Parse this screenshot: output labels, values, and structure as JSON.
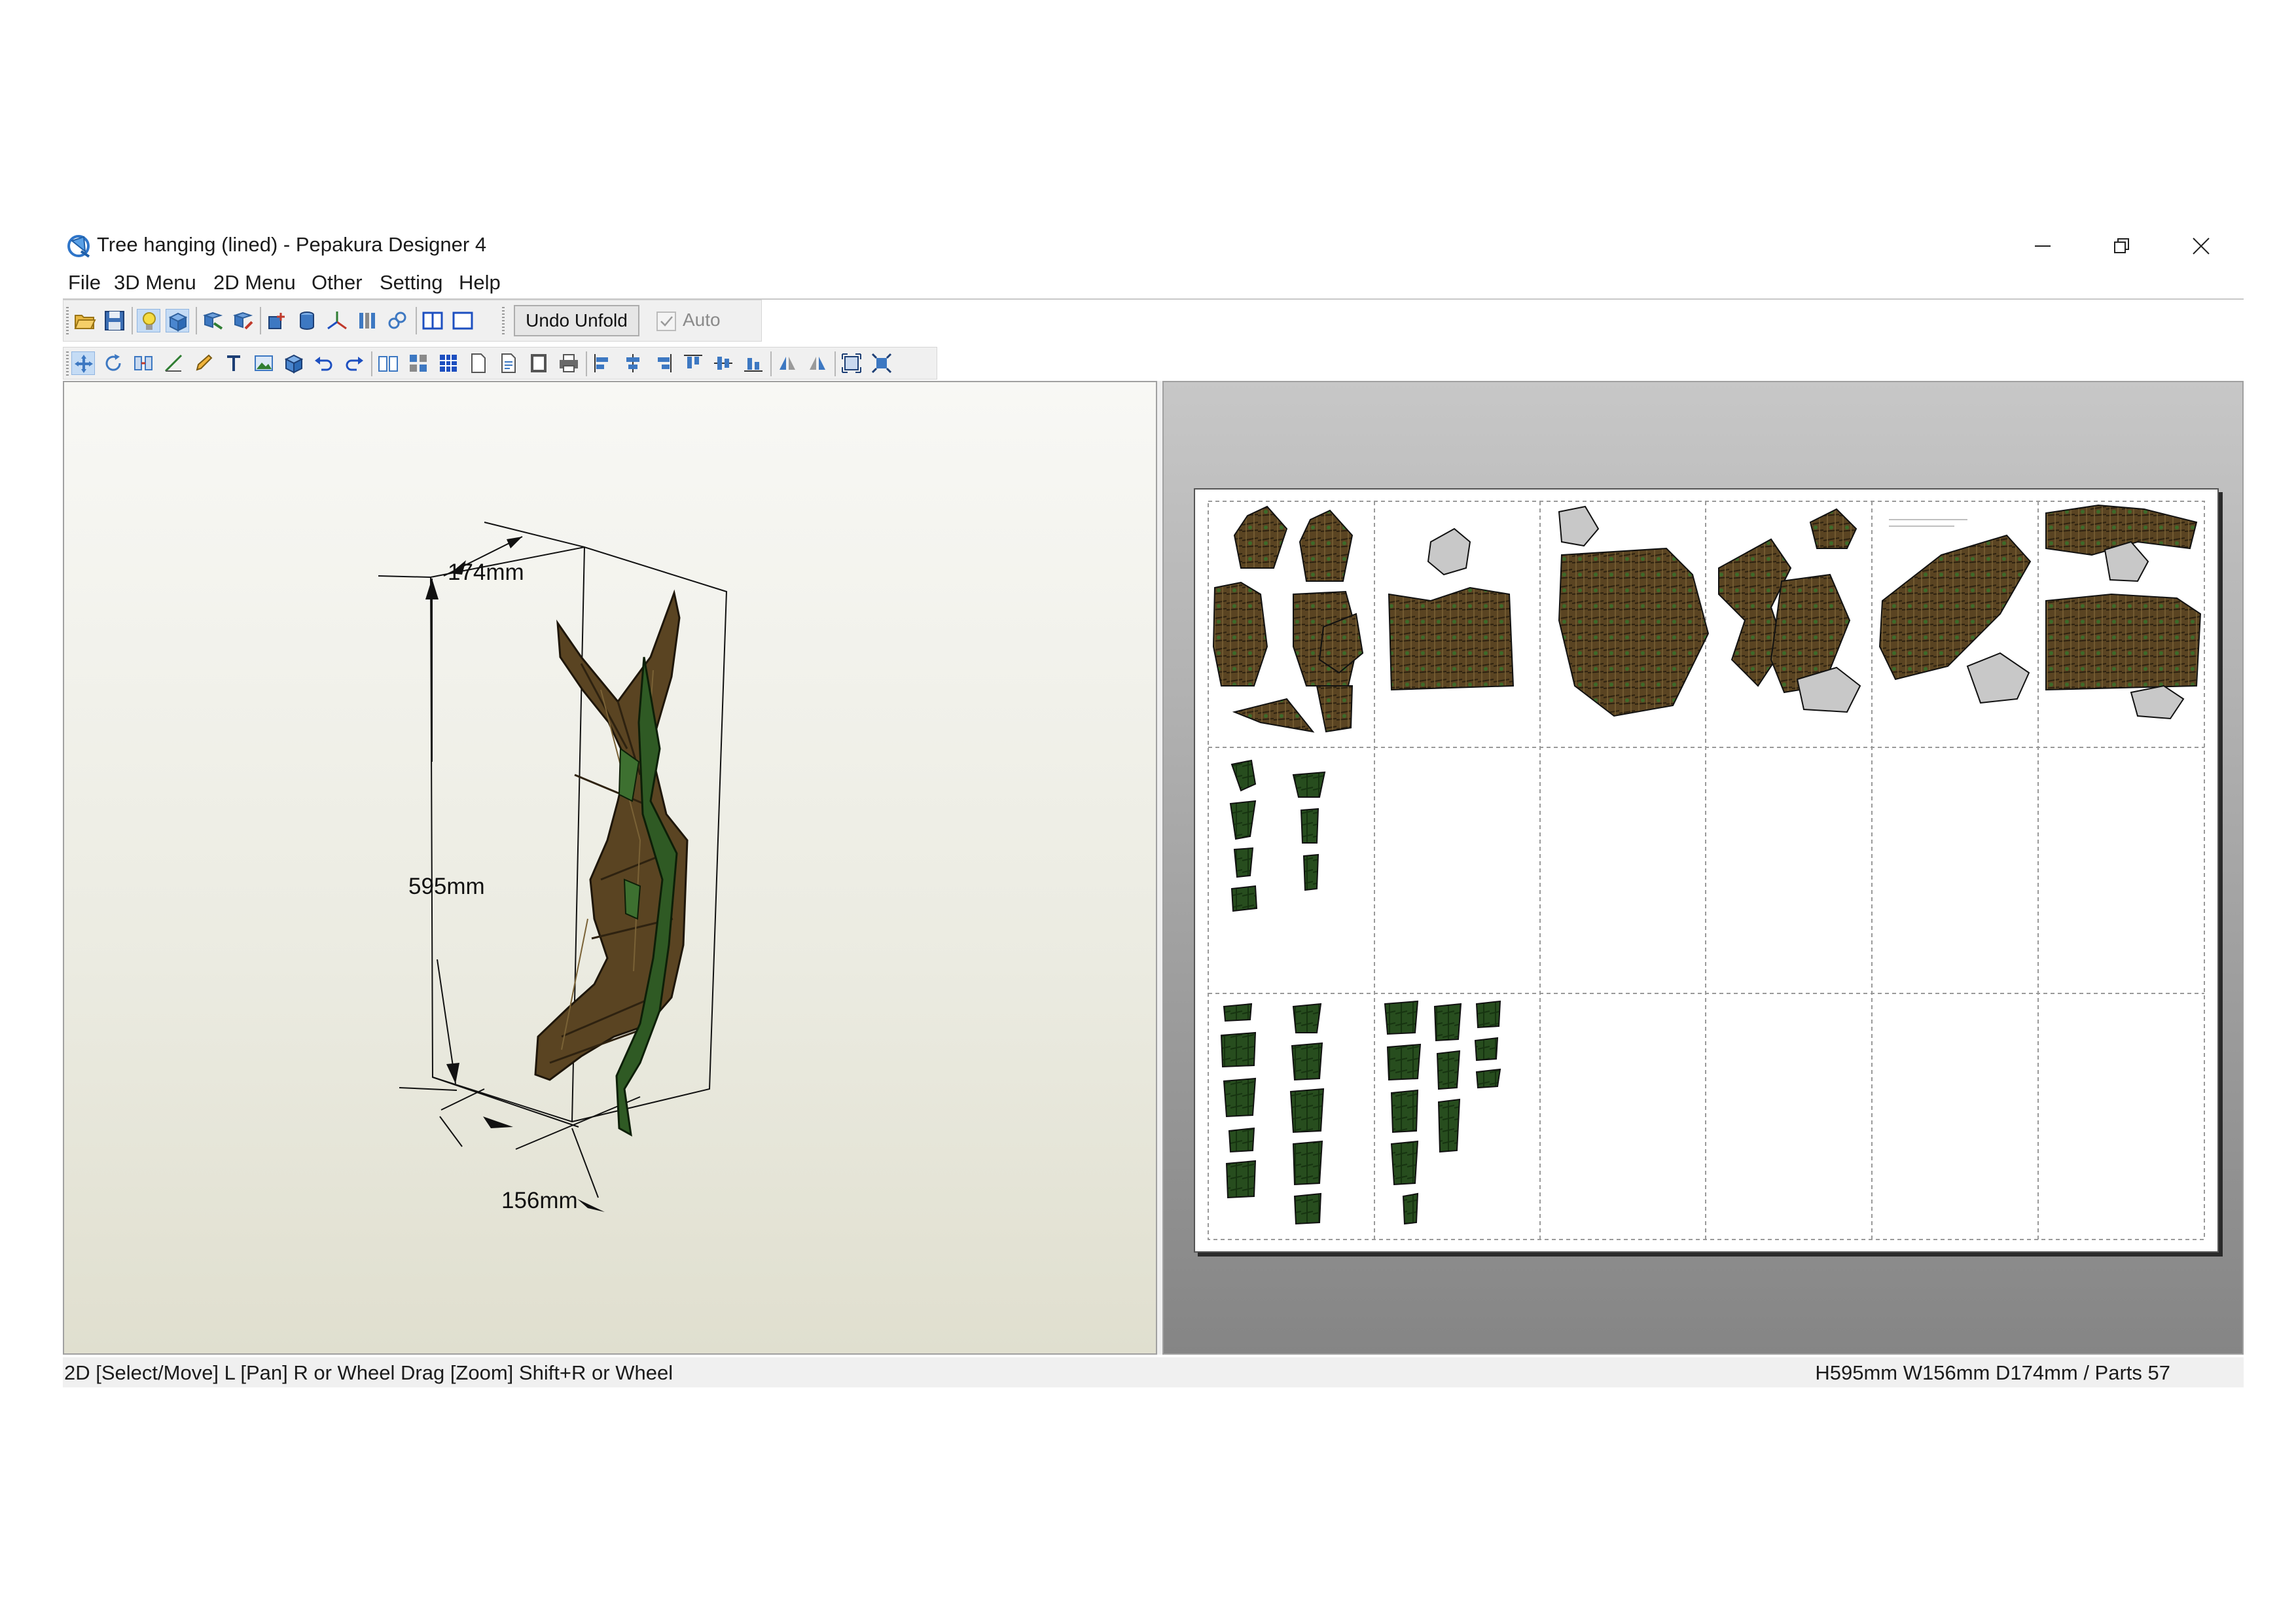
{
  "window": {
    "title": "Tree hanging (lined) - Pepakura Designer 4",
    "controls": [
      "minimize",
      "restore",
      "close"
    ]
  },
  "menu": [
    "File",
    "3D Menu",
    "2D Menu",
    "Other",
    "Setting",
    "Help"
  ],
  "toolbar": {
    "undo_unfold_label": "Undo Unfold",
    "auto_label": "Auto",
    "auto_checked": true
  },
  "view3d": {
    "dimensions": {
      "depth_label": "174mm",
      "height_label": "595mm",
      "width_label": "156mm"
    },
    "model_colors": {
      "bark": "#5a4422",
      "bark_dark": "#2e2210",
      "moss": "#2f5a24"
    }
  },
  "view2d": {
    "pages_cols": 6,
    "pages_rows": 3,
    "paper_color": "#ffffff"
  },
  "status": {
    "left": "2D [Select/Move] L [Pan] R or Wheel Drag [Zoom] Shift+R or Wheel",
    "right": "H595mm W156mm D174mm / Parts 57"
  }
}
